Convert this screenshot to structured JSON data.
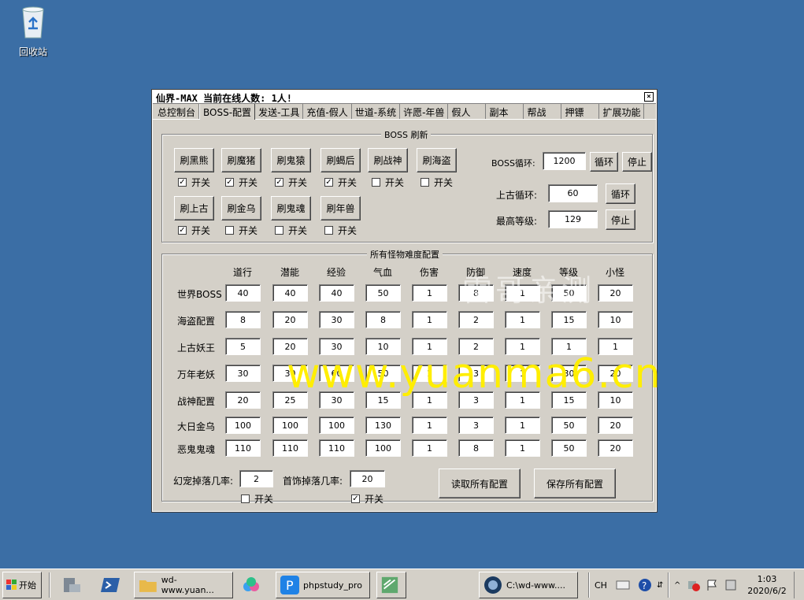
{
  "desktop": {
    "recycle_bin_label": "回收站"
  },
  "window": {
    "title": "仙界-MAX  当前在线人数: 1人!",
    "close_glyph": "×",
    "tabs": [
      "总控制台",
      "BOSS-配置",
      "发送-工具",
      "充值-假人",
      "世道-系统",
      "许愿-年兽",
      "假人",
      "副本",
      "帮战",
      "押镖",
      "扩展功能"
    ],
    "active_tab": "BOSS-配置"
  },
  "boss_refresh": {
    "title": "BOSS 刷新",
    "buttons": [
      {
        "label": "刷黑熊",
        "toggle": "开关",
        "checked": true
      },
      {
        "label": "刷魔猪",
        "toggle": "开关",
        "checked": true
      },
      {
        "label": "刷鬼猿",
        "toggle": "开关",
        "checked": true
      },
      {
        "label": "刷蝎后",
        "toggle": "开关",
        "checked": true
      },
      {
        "label": "刷战神",
        "toggle": "开关",
        "checked": false
      },
      {
        "label": "刷海盗",
        "toggle": "开关",
        "checked": false
      },
      {
        "label": "刷上古",
        "toggle": "开关",
        "checked": true
      },
      {
        "label": "刷金乌",
        "toggle": "开关",
        "checked": false
      },
      {
        "label": "刷鬼魂",
        "toggle": "开关",
        "checked": false
      },
      {
        "label": "刷年兽",
        "toggle": "开关",
        "checked": false
      }
    ],
    "boss_loop_label": "BOSS循环:",
    "boss_loop_value": "1200",
    "loop_button": "循环",
    "stop_button": "停止",
    "ancient_loop_label": "上古循环:",
    "ancient_loop_value": "60",
    "ancient_loop_button": "循环",
    "max_level_label": "最高等级:",
    "max_level_value": "129",
    "max_level_stop_button": "停止"
  },
  "difficulty": {
    "title": "所有怪物难度配置",
    "columns": [
      "道行",
      "潜能",
      "经验",
      "气血",
      "伤害",
      "防御",
      "速度",
      "等级",
      "小怪"
    ],
    "rows": [
      {
        "label": "世界BOSS",
        "values": [
          "40",
          "40",
          "40",
          "50",
          "1",
          "8",
          "1",
          "50",
          "20"
        ]
      },
      {
        "label": "海盗配置",
        "values": [
          "8",
          "20",
          "30",
          "8",
          "1",
          "2",
          "1",
          "15",
          "10"
        ]
      },
      {
        "label": "上古妖王",
        "values": [
          "5",
          "20",
          "30",
          "10",
          "1",
          "2",
          "1",
          "1",
          "1"
        ]
      },
      {
        "label": "万年老妖",
        "values": [
          "30",
          "30",
          "60",
          "50",
          "1",
          "3",
          "1",
          "30",
          "20"
        ]
      },
      {
        "label": "战神配置",
        "values": [
          "20",
          "25",
          "30",
          "15",
          "1",
          "3",
          "1",
          "15",
          "10"
        ]
      },
      {
        "label": "大日金乌",
        "values": [
          "100",
          "100",
          "100",
          "130",
          "1",
          "3",
          "1",
          "50",
          "20"
        ]
      },
      {
        "label": "恶鬼鬼魂",
        "values": [
          "110",
          "110",
          "110",
          "100",
          "1",
          "8",
          "1",
          "50",
          "20"
        ]
      }
    ],
    "pet_drop_label": "幻宠掉落几率:",
    "pet_drop_value": "2",
    "pet_drop_toggle": "开关",
    "pet_drop_checked": false,
    "jewelry_drop_label": "首饰掉落几率:",
    "jewelry_drop_value": "20",
    "jewelry_drop_toggle": "开关",
    "jewelry_drop_checked": true,
    "read_button": "读取所有配置",
    "save_button": "保存所有配置"
  },
  "watermark": {
    "cn_text": "雷哥亲测",
    "url_text": "www.yuanma6.cn"
  },
  "taskbar": {
    "start_label": "开始",
    "explorer_label": "wd-www.yuan...",
    "phpstudy_label": "phpstudy_pro",
    "console_label": "C:\\wd-www....",
    "lang_label": "CH",
    "clock_time": "1:03",
    "clock_date": "2020/6/2"
  },
  "colors": {
    "desktop": "#3b6ea5",
    "window_face": "#d4d0c8",
    "watermark_url": "#ffee00"
  }
}
